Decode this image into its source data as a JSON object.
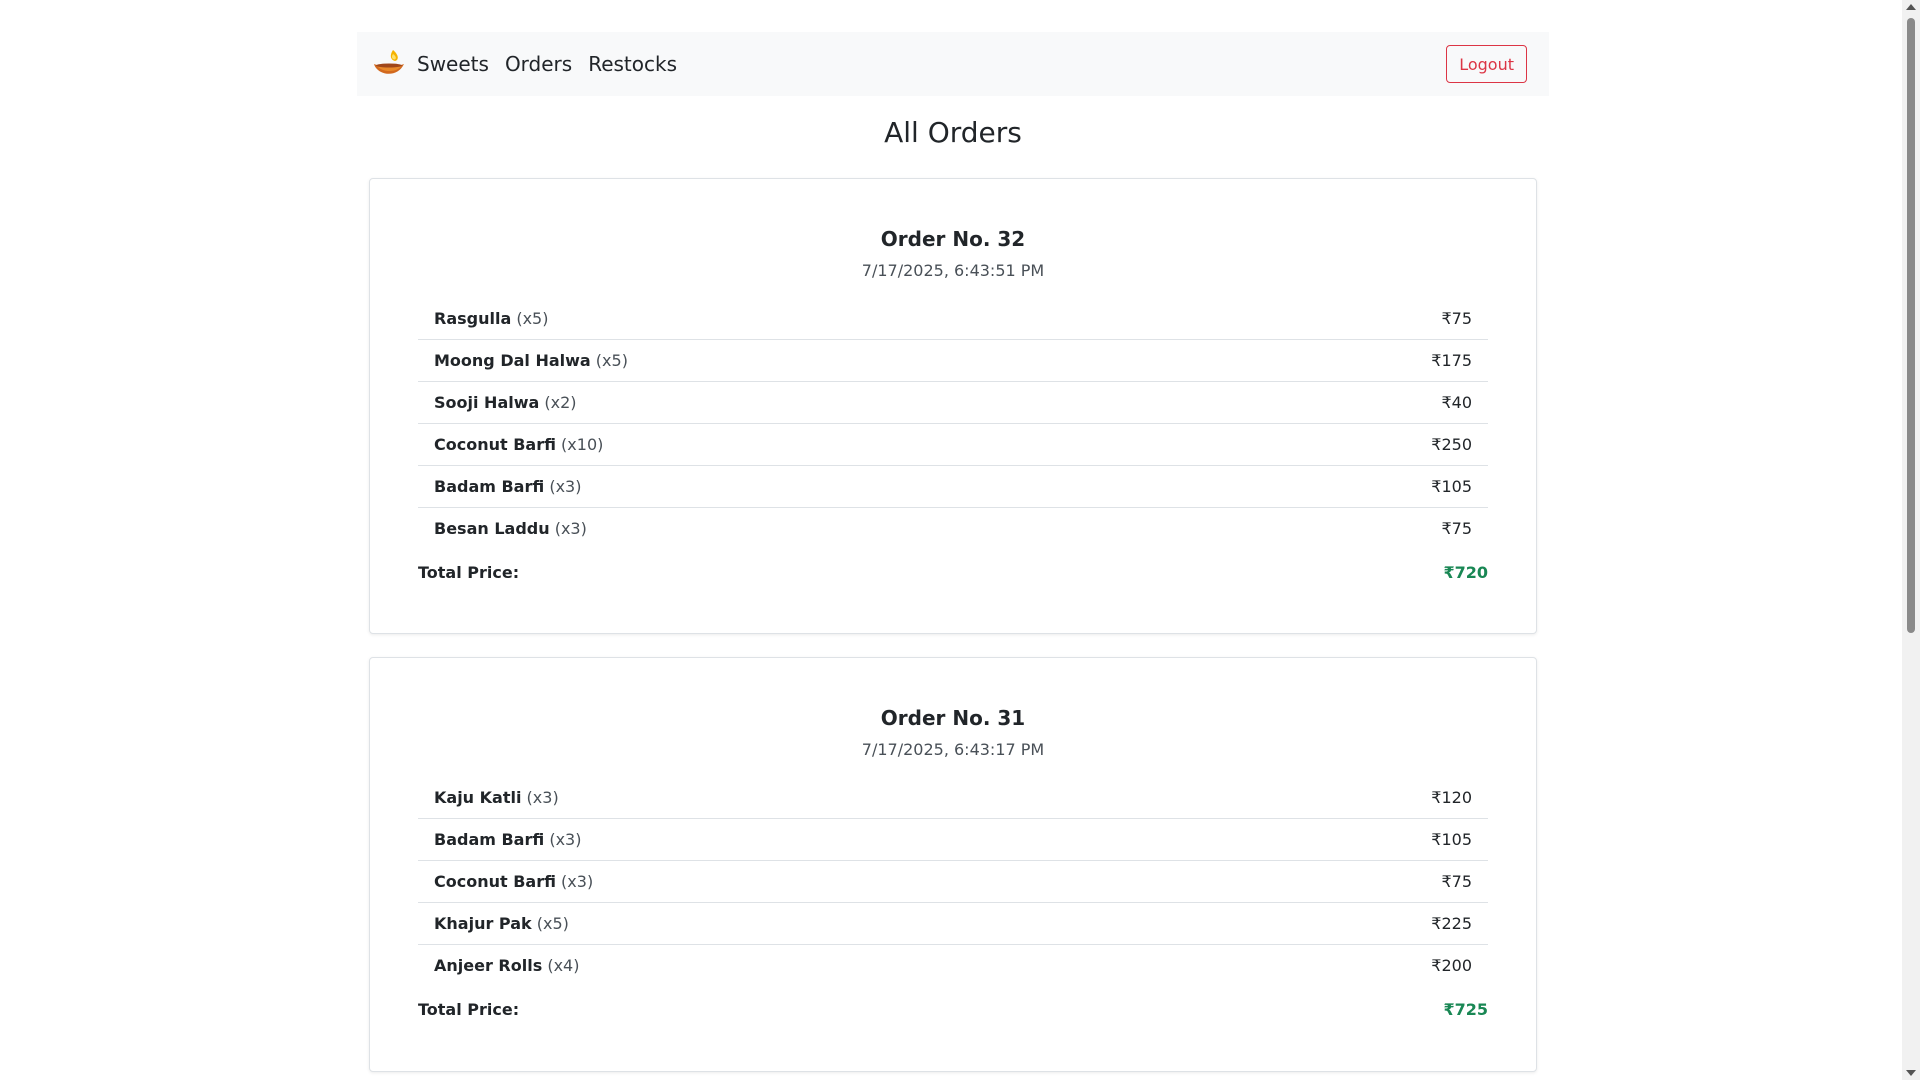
{
  "nav": {
    "brand_icon": "diya-lamp-icon",
    "links": [
      "Sweets",
      "Orders",
      "Restocks"
    ],
    "logout_label": "Logout"
  },
  "page": {
    "title": "All Orders"
  },
  "orders": [
    {
      "title": "Order No. 32",
      "timestamp": "7/17/2025, 6:43:51 PM",
      "items": [
        {
          "name": "Rasgulla",
          "qty": "(x5)",
          "price": "₹75"
        },
        {
          "name": "Moong Dal Halwa",
          "qty": "(x5)",
          "price": "₹175"
        },
        {
          "name": "Sooji Halwa",
          "qty": "(x2)",
          "price": "₹40"
        },
        {
          "name": "Coconut Barfi",
          "qty": "(x10)",
          "price": "₹250"
        },
        {
          "name": "Badam Barfi",
          "qty": "(x3)",
          "price": "₹105"
        },
        {
          "name": "Besan Laddu",
          "qty": "(x3)",
          "price": "₹75"
        }
      ],
      "total_label": "Total Price:",
      "total_value": "₹720"
    },
    {
      "title": "Order No. 31",
      "timestamp": "7/17/2025, 6:43:17 PM",
      "items": [
        {
          "name": "Kaju Katli",
          "qty": "(x3)",
          "price": "₹120"
        },
        {
          "name": "Badam Barfi",
          "qty": "(x3)",
          "price": "₹105"
        },
        {
          "name": "Coconut Barfi",
          "qty": "(x3)",
          "price": "₹75"
        },
        {
          "name": "Khajur Pak",
          "qty": "(x5)",
          "price": "₹225"
        },
        {
          "name": "Anjeer Rolls",
          "qty": "(x4)",
          "price": "₹200"
        }
      ],
      "total_label": "Total Price:",
      "total_value": "₹725"
    }
  ],
  "colors": {
    "logout": "#dc3545",
    "total": "#198754",
    "navbar_bg": "#f8f9fa"
  }
}
